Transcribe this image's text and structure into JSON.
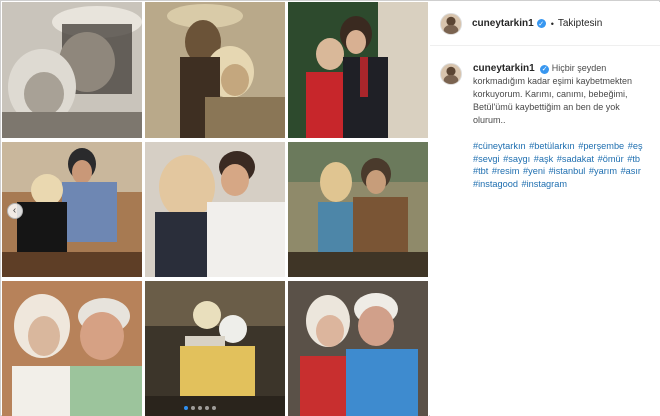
{
  "post": {
    "username": "cuneytarkin1",
    "verified_icon": "verified-badge-icon",
    "separator": "•",
    "follow_status": "Takiptesin",
    "caption_username": "cuneytarkin1",
    "caption": "Hiçbir şeyden korkmadığım kadar eşimi kaybetmekten korkuyorum. Karımı, canımı, bebeğimi, Betül'ümü kaybettiğim an ben de yok olurum..",
    "hashtags": [
      "#cüneytarkın",
      "#betülarkın",
      "#perşembe",
      "#eş",
      "#sevgi",
      "#saygı",
      "#aşk",
      "#sadakat",
      "#ömür",
      "#tb",
      "#tbt",
      "#resim",
      "#yeni",
      "#istanbul",
      "#yarım",
      "#asır",
      "#instagood",
      "#instagram"
    ]
  },
  "carousel": {
    "prev_icon": "chevron-left-icon",
    "glyph": "‹",
    "dot_count": 5,
    "active_dot": 0
  },
  "photos": [
    {
      "name": "photo-1",
      "style": "sepia"
    },
    {
      "name": "photo-2",
      "style": "sepia"
    },
    {
      "name": "photo-3",
      "style": "color"
    },
    {
      "name": "photo-4",
      "style": "color"
    },
    {
      "name": "photo-5",
      "style": "color"
    },
    {
      "name": "photo-6",
      "style": "color"
    },
    {
      "name": "photo-7",
      "style": "color"
    },
    {
      "name": "photo-8",
      "style": "color"
    },
    {
      "name": "photo-9",
      "style": "color"
    }
  ],
  "colors": {
    "link": "#003569",
    "verified": "#3897f0",
    "text": "#262626"
  }
}
